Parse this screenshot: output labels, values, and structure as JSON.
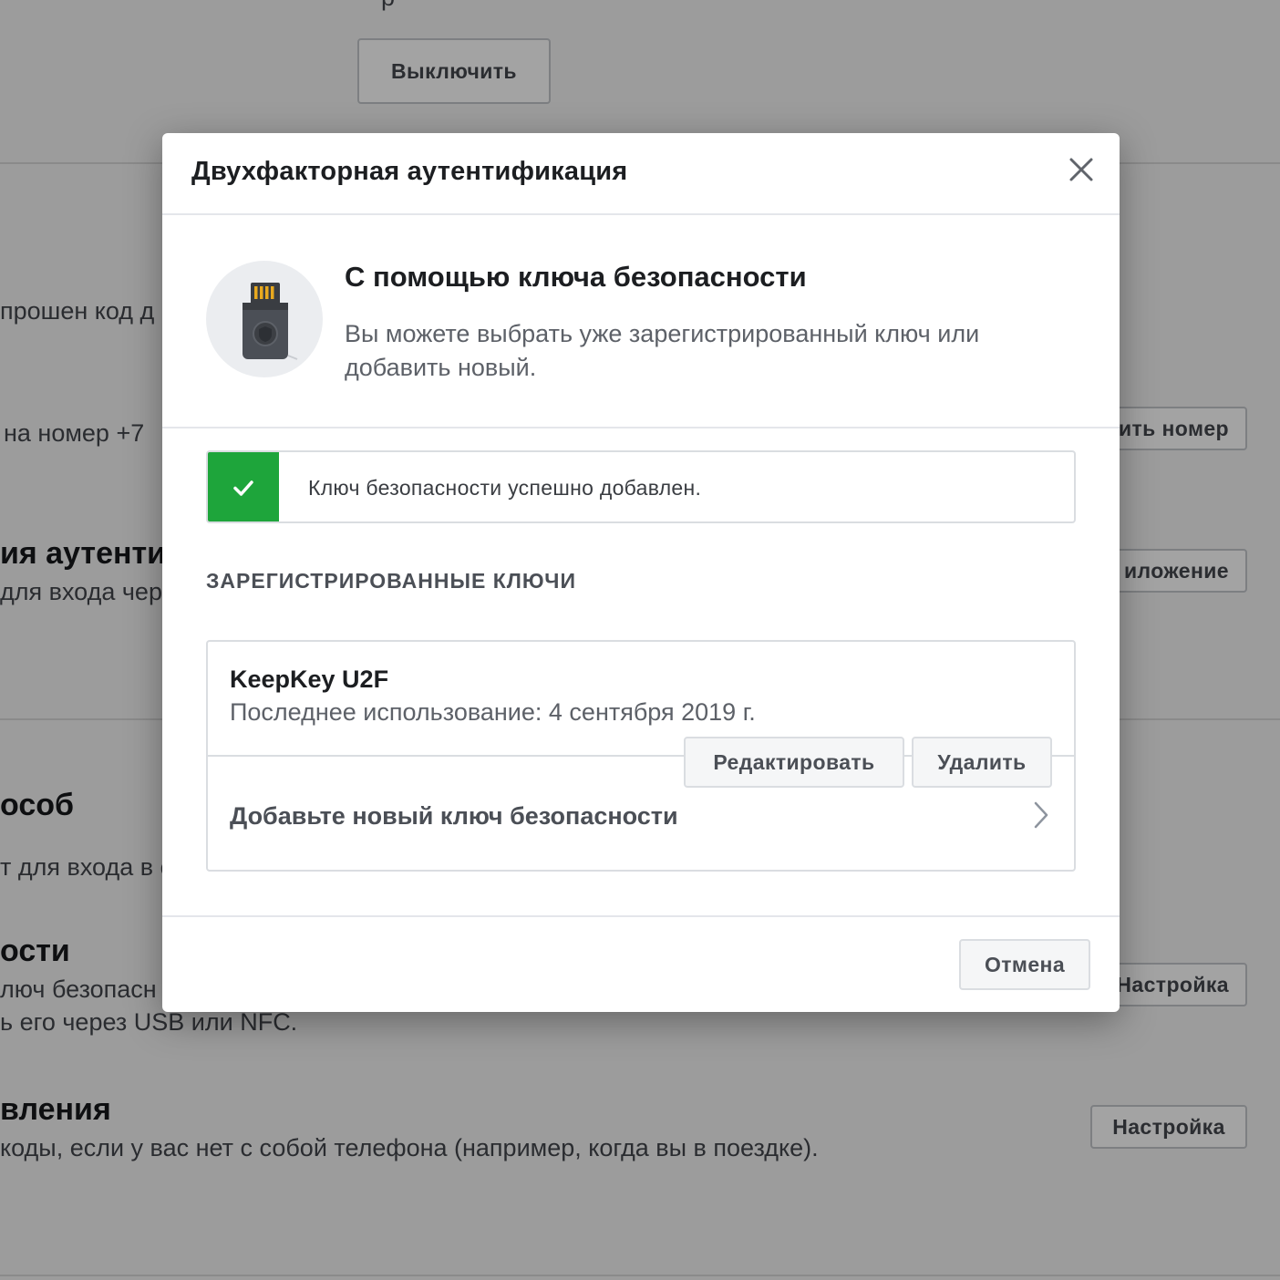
{
  "background": {
    "top_partial_text": "р",
    "top_button": "Выключить",
    "line1": "прошен код д",
    "line2": "на номер +7",
    "button_change_number": "ить номер",
    "section_auth_title": "ия аутентиф",
    "section_auth_desc": "для входа чер",
    "button_app": "иложение",
    "section_method_title": "особ",
    "section_method_desc": "т для входа в с",
    "section_key_title": "ости",
    "section_key_desc1": "люч безопасн",
    "section_key_desc2": "ь его через USB или NFC.",
    "button_setup_1": "Настройка",
    "section_recovery_title": "вления",
    "section_recovery_desc": "коды, если у вас нет с собой телефона (например, когда вы в поездке).",
    "button_setup_2": "Настройка"
  },
  "modal": {
    "title": "Двухфакторная аутентификация",
    "close_icon": "close-icon",
    "intro": {
      "icon": "usb-security-key-icon",
      "title": "С помощью ключа безопасности",
      "text": "Вы можете выбрать уже зарегистрированный ключ или добавить новый."
    },
    "alert": {
      "icon": "checkmark-icon",
      "color": "#1ea53b",
      "text": "Ключ безопасности успешно добавлен."
    },
    "keys_heading": "ЗАРЕГИСТРИРОВАННЫЕ КЛЮЧИ",
    "keys": [
      {
        "name": "KeepKey U2F",
        "last_used": "Последнее использование: 4 сентября 2019 г.",
        "edit_label": "Редактировать",
        "delete_label": "Удалить"
      }
    ],
    "add_key_label": "Добавьте новый ключ безопасности",
    "cancel_label": "Отмена"
  }
}
